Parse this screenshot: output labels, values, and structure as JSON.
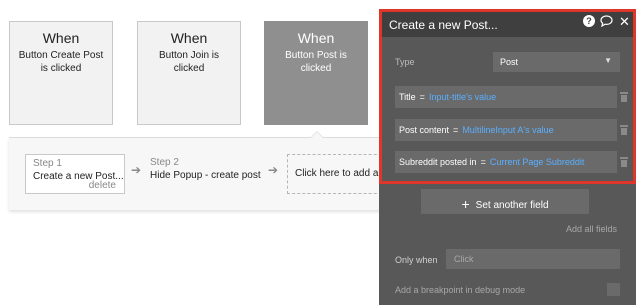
{
  "events": [
    {
      "when": "When",
      "description": "Button Create Post is clicked"
    },
    {
      "when": "When",
      "description": "Button Join is clicked"
    },
    {
      "when": "When",
      "description": "Button Post is clicked"
    }
  ],
  "steps": {
    "step1": {
      "number": "Step 1",
      "title": "Create a new Post...",
      "delete_label": "delete"
    },
    "step2": {
      "number": "Step 2",
      "title": "Hide Popup - create post"
    },
    "add_step_label": "Click here to add an action..."
  },
  "panel": {
    "title": "Create a new Post...",
    "help_icon": "?",
    "type_label": "Type",
    "type_value": "Post",
    "fields": [
      {
        "name": "Title",
        "eq": "=",
        "value": "Input-title's value"
      },
      {
        "name": "Post content",
        "eq": "=",
        "value": "MultilineInput A's value"
      },
      {
        "name": "Subreddit posted in",
        "eq": "=",
        "value": "Current Page Subreddit"
      }
    ],
    "set_another_field": "Set another field",
    "add_all_fields": "Add all fields",
    "only_when_label": "Only when",
    "only_when_placeholder": "Click",
    "breakpoint_label": "Add a breakpoint in debug mode"
  },
  "colors": {
    "panel_bg": "#585858",
    "header_bg": "#3f3f3f",
    "highlight_border": "#e0352b",
    "dynamic_value": "#5ab0ff"
  }
}
